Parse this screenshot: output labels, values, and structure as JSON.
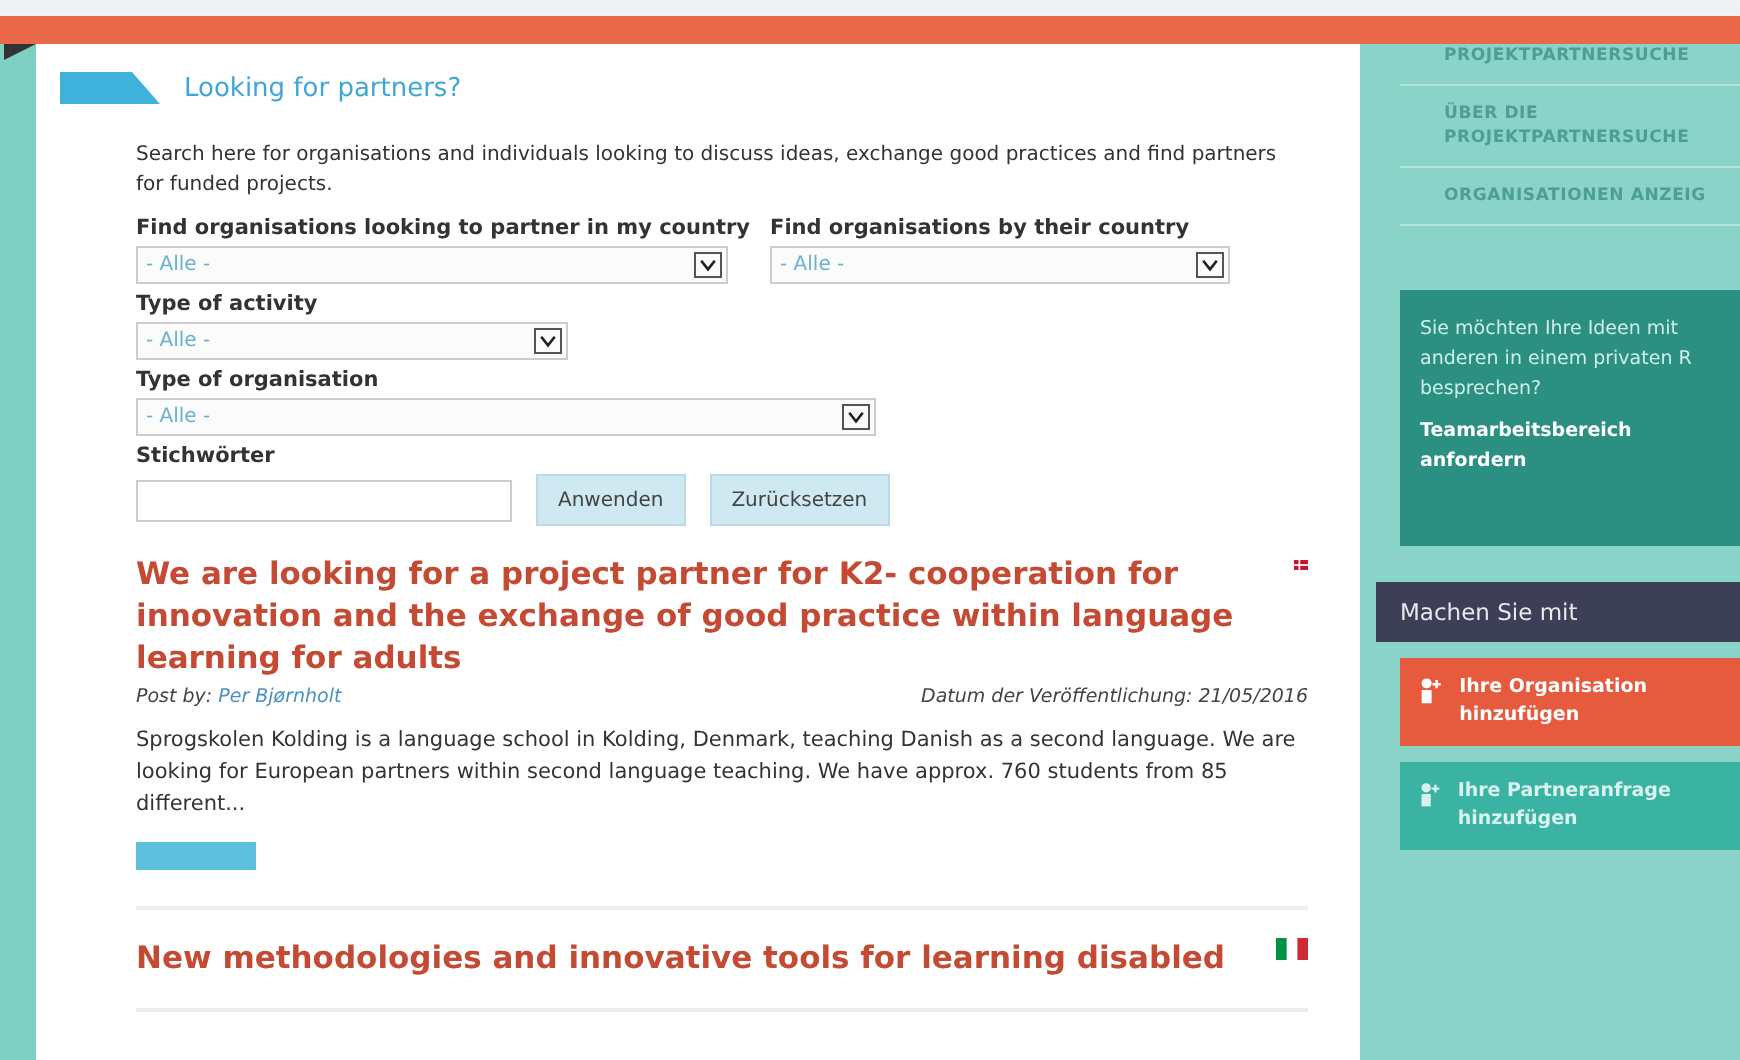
{
  "header": {
    "title": "Looking for partners?"
  },
  "intro": "Search here for organisations and individuals looking to discuss ideas, exchange good practices and find partners for funded projects.",
  "filters": [
    {
      "label": "Find organisations looking to partner in my country",
      "value": "- Alle -"
    },
    {
      "label": "Find organisations by their country",
      "value": "- Alle -"
    },
    {
      "label": "Type of activity",
      "value": "- Alle -"
    },
    {
      "label": "Type of organisation",
      "value": "- Alle -"
    }
  ],
  "keywords": {
    "label": "Stichwörter"
  },
  "buttons": [
    "Anwenden",
    "Zurücksetzen"
  ],
  "posts": [
    {
      "title": "We are looking for a project partner for K2- cooperation for innovation and the exchange of good practice within language learning for adults",
      "kind": "danish",
      "by_label": "Post by:",
      "author": "Per Bjørnholt",
      "date": "Datum der Veröffentlichung: 21/05/2016",
      "excerpt": "Sprogskolen Kolding is a language school  in Kolding, Denmark, teaching Danish as a second language. We are looking for European partners within second language teaching. We have approx. 760 students from 85 different..."
    },
    {
      "title": "New methodologies and innovative tools for learning disabled",
      "kind": "italian"
    }
  ],
  "sidebar": {
    "nav": [
      "PROJEKTPARTNERSUCHE",
      "ÜBER DIE PROJEKTPARTNERSUCHE",
      "ORGANISATIONEN ANZEIG"
    ],
    "promo": {
      "text": "Sie möchten Ihre Ideen mit anderen in einem privaten R besprechen?",
      "link": "Teamarbeitsbereich anfordern"
    },
    "join": {
      "title": "Machen Sie mit",
      "actions": [
        {
          "label": "Ihre Organisation hinzufügen",
          "kind": "primary"
        },
        {
          "label": "Ihre Partneranfrage hinzufügen",
          "kind": "secondary"
        }
      ]
    }
  }
}
